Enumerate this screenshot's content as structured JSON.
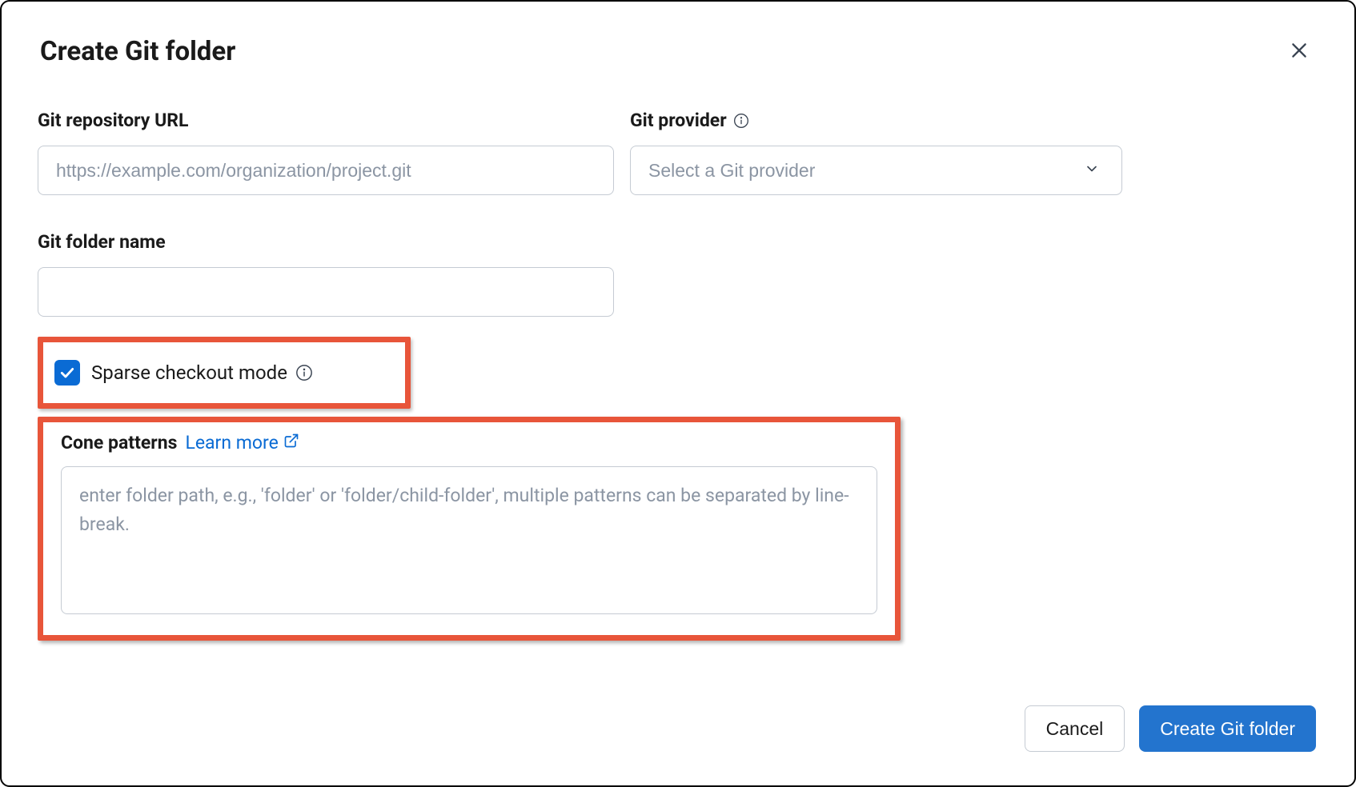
{
  "dialog": {
    "title": "Create Git folder",
    "close_icon": "close"
  },
  "fields": {
    "repo_url": {
      "label": "Git repository URL",
      "placeholder": "https://example.com/organization/project.git",
      "value": ""
    },
    "provider": {
      "label": "Git provider",
      "placeholder": "Select a Git provider",
      "value": ""
    },
    "folder_name": {
      "label": "Git folder name",
      "value": ""
    },
    "sparse_checkout": {
      "label": "Sparse checkout mode",
      "checked": true
    },
    "cone_patterns": {
      "label": "Cone patterns",
      "learn_more": "Learn more",
      "placeholder": "enter folder path, e.g., 'folder' or 'folder/child-folder', multiple patterns can be separated by line-break.",
      "value": ""
    }
  },
  "footer": {
    "cancel": "Cancel",
    "submit": "Create Git folder"
  }
}
